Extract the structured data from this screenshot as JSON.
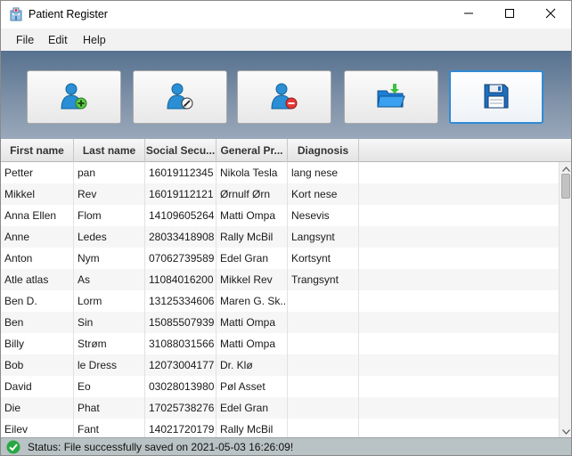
{
  "window": {
    "title": "Patient Register",
    "icons": {
      "app": "hospital-icon",
      "minimize": "minimize-icon",
      "maximize": "maximize-icon",
      "close": "close-icon"
    }
  },
  "menu": {
    "items": [
      "File",
      "Edit",
      "Help"
    ]
  },
  "toolbar": {
    "buttons": [
      {
        "icon": "add-patient-icon"
      },
      {
        "icon": "edit-patient-icon"
      },
      {
        "icon": "remove-patient-icon"
      },
      {
        "icon": "open-folder-icon"
      },
      {
        "icon": "save-icon"
      }
    ]
  },
  "table": {
    "columns": [
      "First name",
      "Last name",
      "Social Secu...",
      "General Pr...",
      "Diagnosis",
      ""
    ],
    "rows": [
      [
        "Petter",
        "pan",
        "16019112345",
        "Nikola Tesla",
        "lang nese"
      ],
      [
        "Mikkel",
        "Rev",
        "16019112121",
        "Ørnulf Ørn",
        "Kort nese"
      ],
      [
        "Anna Ellen",
        "Flom",
        "14109605264",
        "Matti Ompa",
        "Nesevis"
      ],
      [
        "Anne",
        "Ledes",
        "28033418908",
        "Rally McBil",
        "Langsynt"
      ],
      [
        "Anton",
        "Nym",
        "07062739589",
        "Edel Gran",
        "Kortsynt"
      ],
      [
        "Atle atlas",
        "As",
        "11084016200",
        "Mikkel Rev",
        "Trangsynt"
      ],
      [
        "Ben D.",
        "Lorm",
        "13125334606",
        "Maren G. Sk...",
        ""
      ],
      [
        "Ben",
        "Sin",
        "15085507939",
        "Matti Ompa",
        ""
      ],
      [
        "Billy",
        "Strøm",
        "31088031566",
        "Matti Ompa",
        ""
      ],
      [
        "Bob",
        "le Dress",
        "12073004177",
        "Dr. Klø",
        ""
      ],
      [
        "David",
        "Eo",
        "03028013980",
        "Pøl Asset",
        ""
      ],
      [
        "Die",
        "Phat",
        "17025738276",
        "Edel Gran",
        ""
      ],
      [
        "Eilev",
        "Fant",
        "14021720179",
        "Rally McBil",
        ""
      ]
    ]
  },
  "status": {
    "icon": "check-circle-icon",
    "text": "Status: File successfully saved on 2021-05-03 16:26:09!"
  }
}
